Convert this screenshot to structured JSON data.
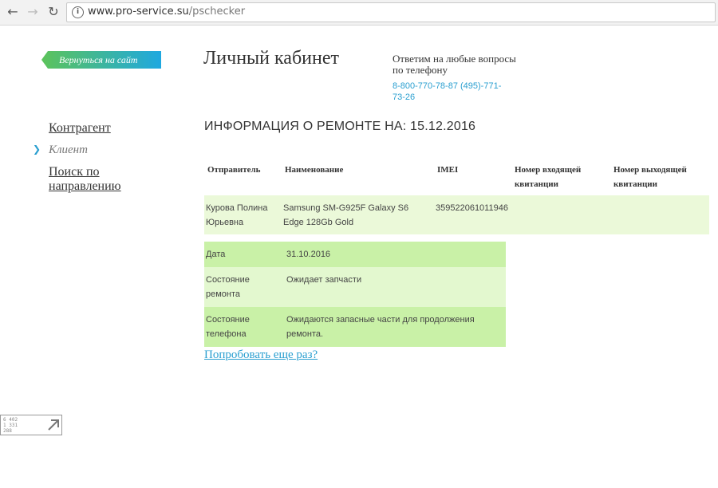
{
  "browser": {
    "url_host": "www.pro-service.su",
    "url_path": "/pschecker",
    "icons": [
      "back-arrow-icon",
      "forward-arrow-icon",
      "reload-icon",
      "info-icon"
    ]
  },
  "header": {
    "back_link": "Вернуться на сайт",
    "title": "Личный кабинет",
    "contact_text": "Ответим на любые вопросы по телефону",
    "phone": "8-800-770-78-87 (495)-771-73-26"
  },
  "sidebar": {
    "items": [
      {
        "label": "Контрагент",
        "active": false
      },
      {
        "label": "Клиент",
        "active": true
      },
      {
        "label": "Поиск по направлению",
        "active": false
      }
    ]
  },
  "main": {
    "heading": "ИНФОРМАЦИЯ О РЕМОНТЕ НА: 15.12.2016",
    "device_table": {
      "headers": [
        "Отправитель",
        "Наименование",
        "IMEI",
        "Номер входящей квитанции",
        "Номер выходящей квитанции"
      ],
      "row": {
        "sender": "Курова Полина Юрьевна",
        "name": "Samsung SM-G925F Galaxy S6 Edge 128Gb Gold",
        "imei": "359522061011946",
        "incoming": "",
        "outgoing": ""
      }
    },
    "status_table": [
      {
        "label": "Дата",
        "value": "31.10.2016"
      },
      {
        "label": "Состояние ремонта",
        "value": "Ожидает запчасти"
      },
      {
        "label": "Состояние телефона",
        "value": "Ожидаются запасные части для продолжения ремонта."
      }
    ],
    "retry_link": "Попробовать еще раз?"
  },
  "counter": {
    "lines": [
      "6 402",
      "1 331",
      "288"
    ]
  },
  "colors": {
    "accent_blue": "#2a9fd0",
    "badge_green": "#5cc35a",
    "row_green_dark": "#c9f1a7",
    "row_green_light": "#e3f8cf",
    "device_row": "#ebf9d9"
  }
}
